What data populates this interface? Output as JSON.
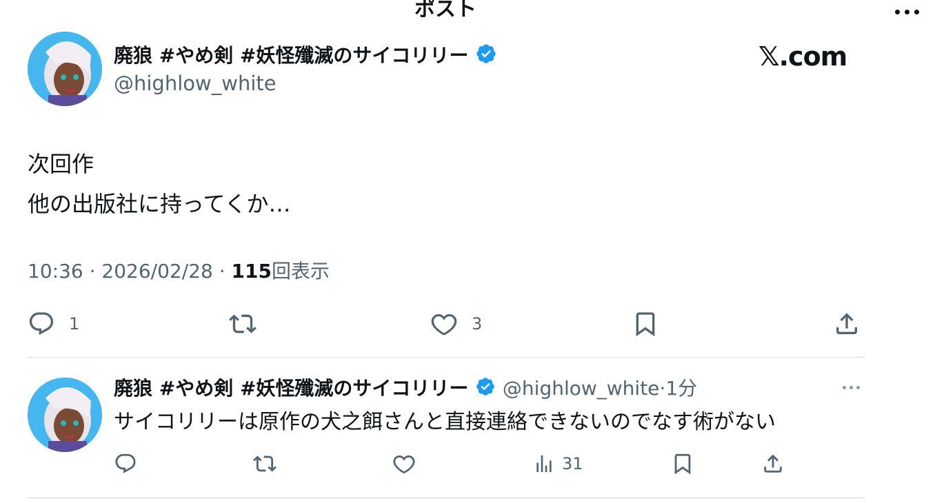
{
  "header": {
    "title": "ポスト",
    "more_icon": "more-horizontal-icon"
  },
  "watermark": "𝕏.com",
  "post": {
    "display_name": "廃狼 #やめ剣 #妖怪殲滅のサイコリリー",
    "handle": "@highlow_white",
    "text_line1": "次回作",
    "text_line2": "他の出版社に持ってくか…",
    "time": "10:36",
    "date": "2026/02/28",
    "separator": " · ",
    "views_count": "115",
    "views_label": "回表示",
    "actions": {
      "reply_count": "1",
      "repost_count": "",
      "like_count": "3"
    }
  },
  "reply": {
    "display_name": "廃狼 #やめ剣 #妖怪殲滅のサイコリリー",
    "handle": "@highlow_white",
    "time_sep": "·",
    "time_ago": "1分",
    "text": "サイコリリーは原作の犬之餌さんと直接連絡できないのでなす術がない",
    "actions": {
      "views_count": "31"
    }
  },
  "colors": {
    "verified": "#1d9bf0",
    "text": "#0f1419",
    "muted": "#536471",
    "divider": "#cfd9de"
  }
}
